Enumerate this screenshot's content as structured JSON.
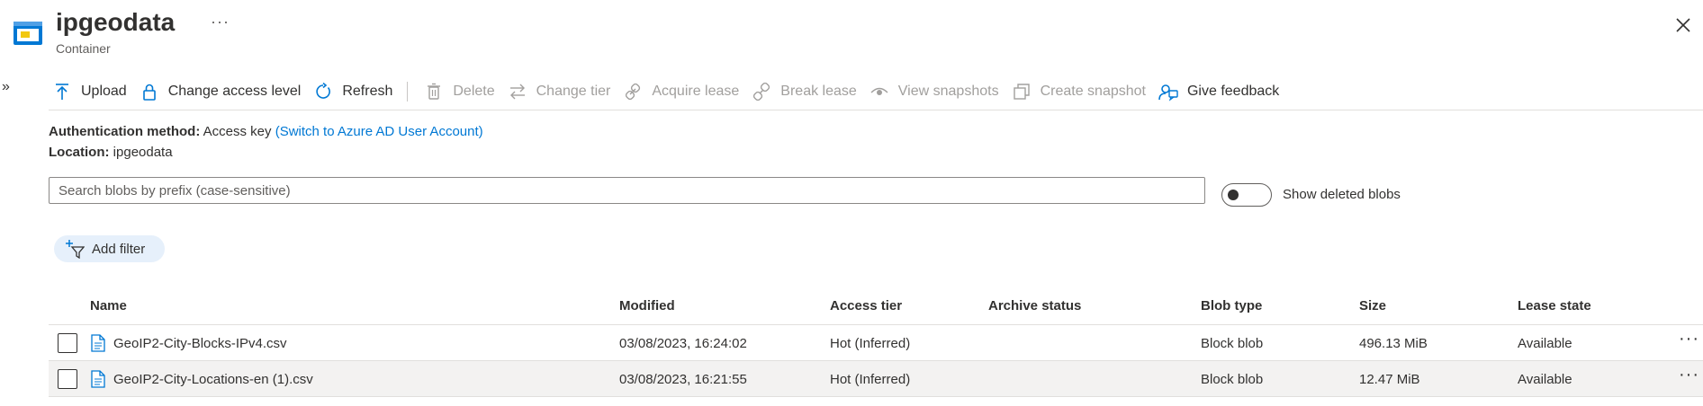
{
  "header": {
    "title": "ipgeodata",
    "subtitle": "Container",
    "more_label": "···",
    "close_label": "close"
  },
  "sidebar": {
    "expand_label": "»"
  },
  "toolbar": {
    "upload": "Upload",
    "change_access_level": "Change access level",
    "refresh": "Refresh",
    "delete": "Delete",
    "change_tier": "Change tier",
    "acquire_lease": "Acquire lease",
    "break_lease": "Break lease",
    "view_snapshots": "View snapshots",
    "create_snapshot": "Create snapshot",
    "give_feedback": "Give feedback"
  },
  "info": {
    "auth_label": "Authentication method:",
    "auth_value": "Access key",
    "auth_link": "(Switch to Azure AD User Account)",
    "location_label": "Location:",
    "location_value": "ipgeodata"
  },
  "search": {
    "placeholder": "Search blobs by prefix (case-sensitive)",
    "value": ""
  },
  "toggle": {
    "label": "Show deleted blobs",
    "on": false
  },
  "filter": {
    "add_label": "Add filter"
  },
  "table": {
    "columns": {
      "name": "Name",
      "modified": "Modified",
      "access_tier": "Access tier",
      "archive_status": "Archive status",
      "blob_type": "Blob type",
      "size": "Size",
      "lease_state": "Lease state"
    },
    "rows": [
      {
        "name": "GeoIP2-City-Blocks-IPv4.csv",
        "modified": "03/08/2023, 16:24:02",
        "access_tier": "Hot (Inferred)",
        "archive_status": "",
        "blob_type": "Block blob",
        "size": "496.13 MiB",
        "lease_state": "Available",
        "more": "···"
      },
      {
        "name": "GeoIP2-City-Locations-en (1).csv",
        "modified": "03/08/2023, 16:21:55",
        "access_tier": "Hot (Inferred)",
        "archive_status": "",
        "blob_type": "Block blob",
        "size": "12.47 MiB",
        "lease_state": "Available",
        "more": "···"
      }
    ]
  },
  "colors": {
    "accent": "#0078d4",
    "text": "#323130",
    "disabled": "#a19f9d",
    "filter_pill": "#e6f0fb"
  },
  "icons": [
    "container-icon",
    "close-icon",
    "upload-icon",
    "lock-icon",
    "refresh-icon",
    "trash-icon",
    "swap-icon",
    "link-icon",
    "broken-link-icon",
    "eye-icon",
    "snapshot-icon",
    "feedback-icon",
    "filter-icon",
    "file-icon"
  ]
}
